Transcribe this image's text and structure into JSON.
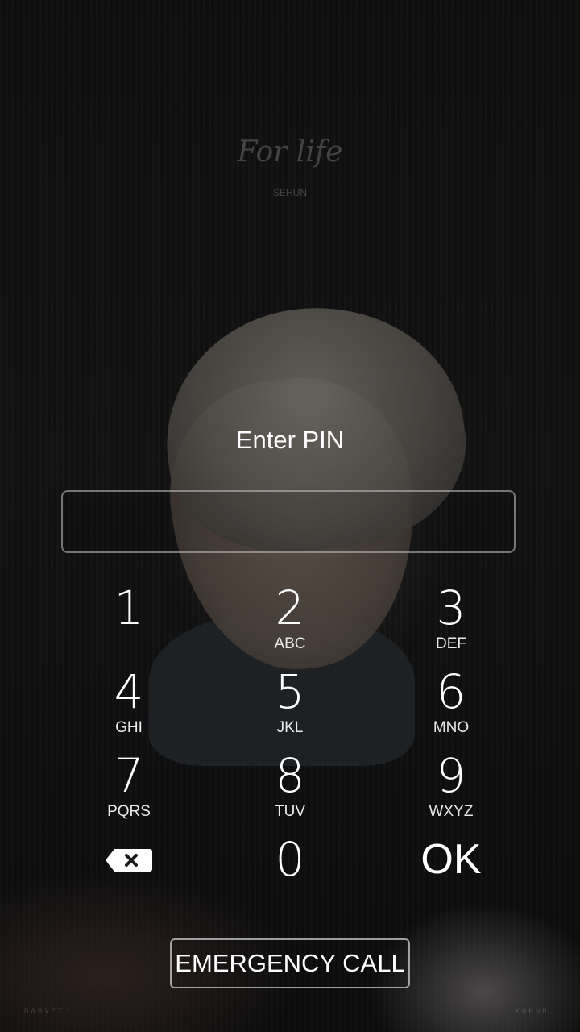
{
  "wallpaper": {
    "title": "For life",
    "subtitle": "SEHUN",
    "corner_left": "DΛBVΞT'",
    "corner_right": "YOHUD."
  },
  "lock_screen": {
    "title": "Enter PIN",
    "pin_value": ""
  },
  "keypad": {
    "keys": [
      {
        "digit": "1",
        "letters": ""
      },
      {
        "digit": "2",
        "letters": "ABC"
      },
      {
        "digit": "3",
        "letters": "DEF"
      },
      {
        "digit": "4",
        "letters": "GHI"
      },
      {
        "digit": "5",
        "letters": "JKL"
      },
      {
        "digit": "6",
        "letters": "MNO"
      },
      {
        "digit": "7",
        "letters": "PQRS"
      },
      {
        "digit": "8",
        "letters": "TUV"
      },
      {
        "digit": "9",
        "letters": "WXYZ"
      },
      {
        "digit": "0",
        "letters": ""
      }
    ],
    "ok_label": "OK",
    "backspace_icon": "backspace-icon"
  },
  "emergency_call_label": "EMERGENCY CALL",
  "colors": {
    "background": "#0d0d0e",
    "text": "#ffffff"
  }
}
